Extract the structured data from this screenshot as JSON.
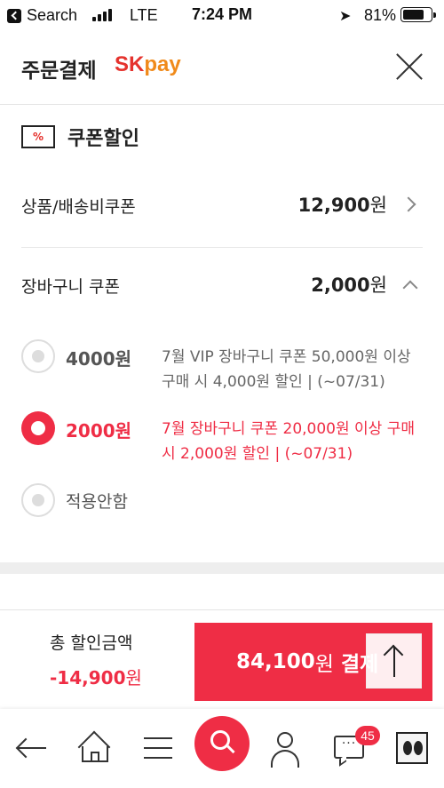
{
  "status_bar": {
    "back_app_label": "Search",
    "network": "LTE",
    "time": "7:24 PM",
    "location_icon": "location-arrow-icon",
    "battery_percent": "81%",
    "battery_level": 0.81
  },
  "header": {
    "title": "주문결제",
    "logo_sk": "SK",
    "logo_pay": "pay",
    "close_icon": "close-icon"
  },
  "coupon": {
    "icon_text": "%",
    "title": "쿠폰할인",
    "product_shipping": {
      "label": "상품/배송비쿠폰",
      "value": "12,900",
      "unit": "원"
    },
    "cart": {
      "label": "장바구니 쿠폰",
      "value": "2,000",
      "unit": "원"
    },
    "options": [
      {
        "amount": "4000원",
        "description": "7월 VIP 장바구니 쿠폰 50,000원 이상 구매 시 4,000원 할인 | (~07/31)",
        "selected": false
      },
      {
        "amount": "2000원",
        "description": "7월 장바구니 쿠폰 20,000원 이상 구매 시 2,000원 할인 | (~07/31)",
        "selected": true
      },
      {
        "label": "적용안함",
        "selected": false
      }
    ]
  },
  "pay_bar": {
    "discount_label": "총 할인금액",
    "discount_amount": "-14,900",
    "discount_unit": "원",
    "pay_amount": "84,100",
    "pay_unit": "원",
    "pay_text": "결제"
  },
  "bottom_nav": {
    "chat_badge": "45",
    "chat_dots": "···"
  },
  "colors": {
    "accent": "#ef2d45",
    "sk_red": "#e5322d",
    "pay_orange": "#f08a1a"
  }
}
